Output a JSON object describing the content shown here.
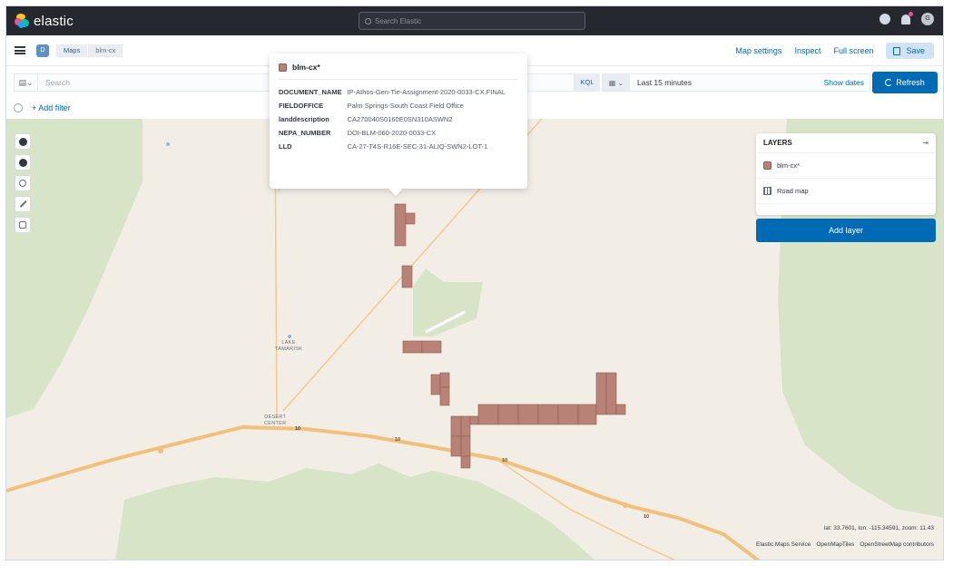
{
  "header": {
    "logo_text": "elastic",
    "search_placeholder": "Search Elastic",
    "icons": [
      "help-icon",
      "notifications-icon",
      "user-avatar-icon"
    ],
    "avatar_initials": "G"
  },
  "breadcrumb": {
    "space_letter": "D",
    "items": [
      "Maps",
      "blm-cx"
    ]
  },
  "toolbar": {
    "map_settings": "Map settings",
    "inspect": "Inspect",
    "full_screen": "Full screen",
    "save": "Save"
  },
  "query": {
    "placeholder": "Search",
    "language": "KQL",
    "time_range": "Last 15 minutes",
    "show_dates": "Show dates",
    "refresh": "Refresh",
    "add_filter": "+ Add filter"
  },
  "tooltip": {
    "layer_name": "blm-cx*",
    "rows": [
      {
        "key": "DOCUMENT_NAME",
        "value": "IP-Athos-Gen-Tie-Assignment-2020-0033-CX.FINAL"
      },
      {
        "key": "FIELDOFFICE",
        "value": "Palm Springs-South Coast Field Office"
      },
      {
        "key": "landdescription",
        "value": "CA270040S0160E0SN310ASWN2"
      },
      {
        "key": "NEPA_NUMBER",
        "value": "DOI-BLM-060-2020-0033-CX"
      },
      {
        "key": "LLD",
        "value": "CA-27-T4S-R16E-SEC-31-ALIQ-SWN2-LOT-1"
      }
    ]
  },
  "layers_panel": {
    "title": "LAYERS",
    "items": [
      {
        "name": "blm-cx*",
        "icon": "polygon-swatch-icon"
      },
      {
        "name": "Road map",
        "icon": "grid-tiles-icon"
      }
    ],
    "add_layer": "Add layer"
  },
  "map": {
    "labels": {
      "lake_tamarisk": "LAKE\nTAMARISK",
      "desert_center": "DESERT\nCENTER"
    },
    "road_numbers": [
      "10",
      "10",
      "10",
      "10"
    ],
    "coordinates": "lat: 33.7601, lon: -115.34591, zoom: 11.43",
    "attribution": [
      "Elastic Maps Service",
      "OpenMapTiles",
      "OpenStreetMap contributors"
    ],
    "colors": {
      "land": "#f2eee6",
      "park": "#d7e4c8",
      "road": "#f3c98d",
      "polygon_fill": "#b98277",
      "polygon_stroke": "#8d5b50"
    }
  }
}
